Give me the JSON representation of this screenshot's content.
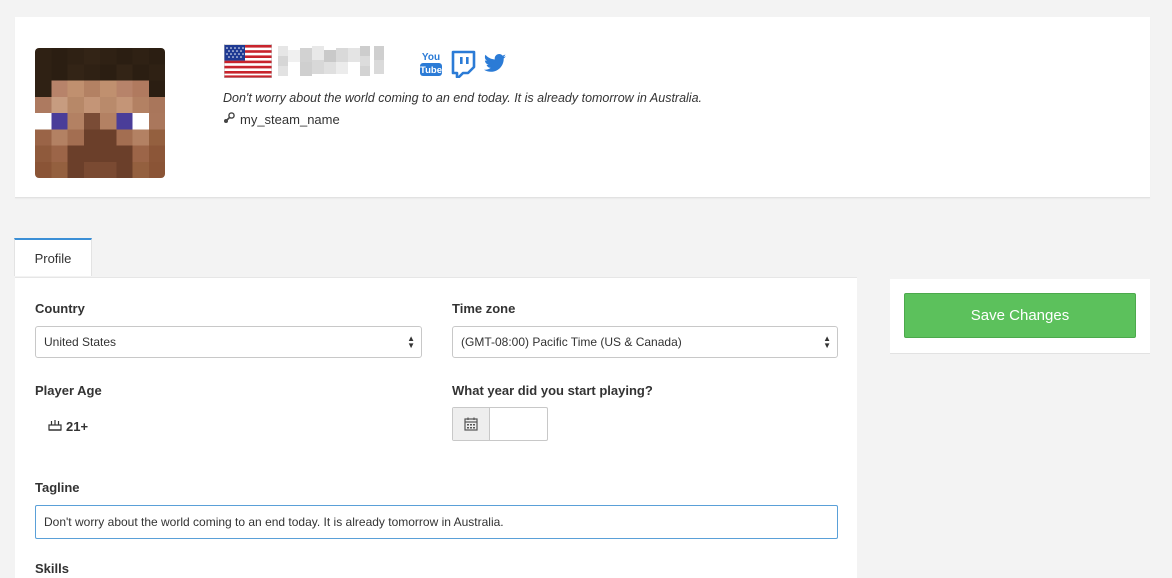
{
  "header": {
    "flag_icon": "us-flag-icon",
    "tagline": "Don't worry about the world coming to an end today. It is already tomorrow in Australia.",
    "steam_icon": "steam-icon",
    "steam_name": "my_steam_name",
    "socials": [
      "youtube-icon",
      "twitch-icon",
      "twitter-icon"
    ],
    "colors": {
      "social": "#2b7bd6",
      "flag_red": "#c8232c",
      "flag_blue": "#1f3a93"
    }
  },
  "tabs": [
    {
      "label": "Profile"
    }
  ],
  "form": {
    "country": {
      "label": "Country",
      "value": "United States"
    },
    "timezone": {
      "label": "Time zone",
      "value": "(GMT-08:00) Pacific Time (US & Canada)"
    },
    "player_age": {
      "label": "Player Age",
      "value": "21+"
    },
    "start_year": {
      "label": "What year did you start playing?",
      "value": ""
    },
    "tagline": {
      "label": "Tagline",
      "value": "Don't worry about the world coming to an end today. It is already tomorrow in Australia."
    },
    "skills": {
      "label": "Skills"
    }
  },
  "actions": {
    "save_label": "Save Changes",
    "save_color": "#5cc15c"
  }
}
